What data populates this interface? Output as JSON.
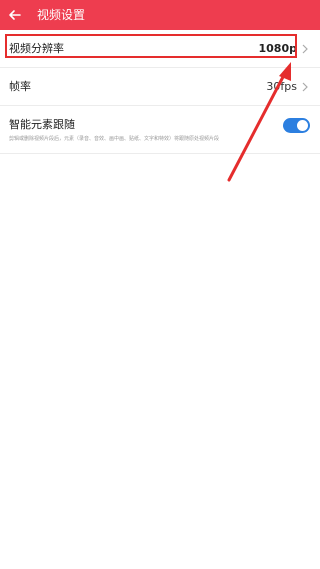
{
  "header": {
    "title": "视频设置",
    "back_icon": "arrow-left-icon",
    "background_color": "#ee3d4f"
  },
  "settings": {
    "resolution": {
      "label": "视频分辨率",
      "value": "1080p"
    },
    "frame_rate": {
      "label": "帧率",
      "value": "30fps"
    },
    "smart_tracking": {
      "label": "智能元素跟随",
      "description": "剪辑或删除视频片段后，元素（录音、音效、画中画、贴纸、文字和特效）将跟随原处视频片段",
      "enabled": true
    }
  },
  "annotation": {
    "highlight_color": "#e52d2d",
    "toggle_color": "#2c7fe0"
  }
}
